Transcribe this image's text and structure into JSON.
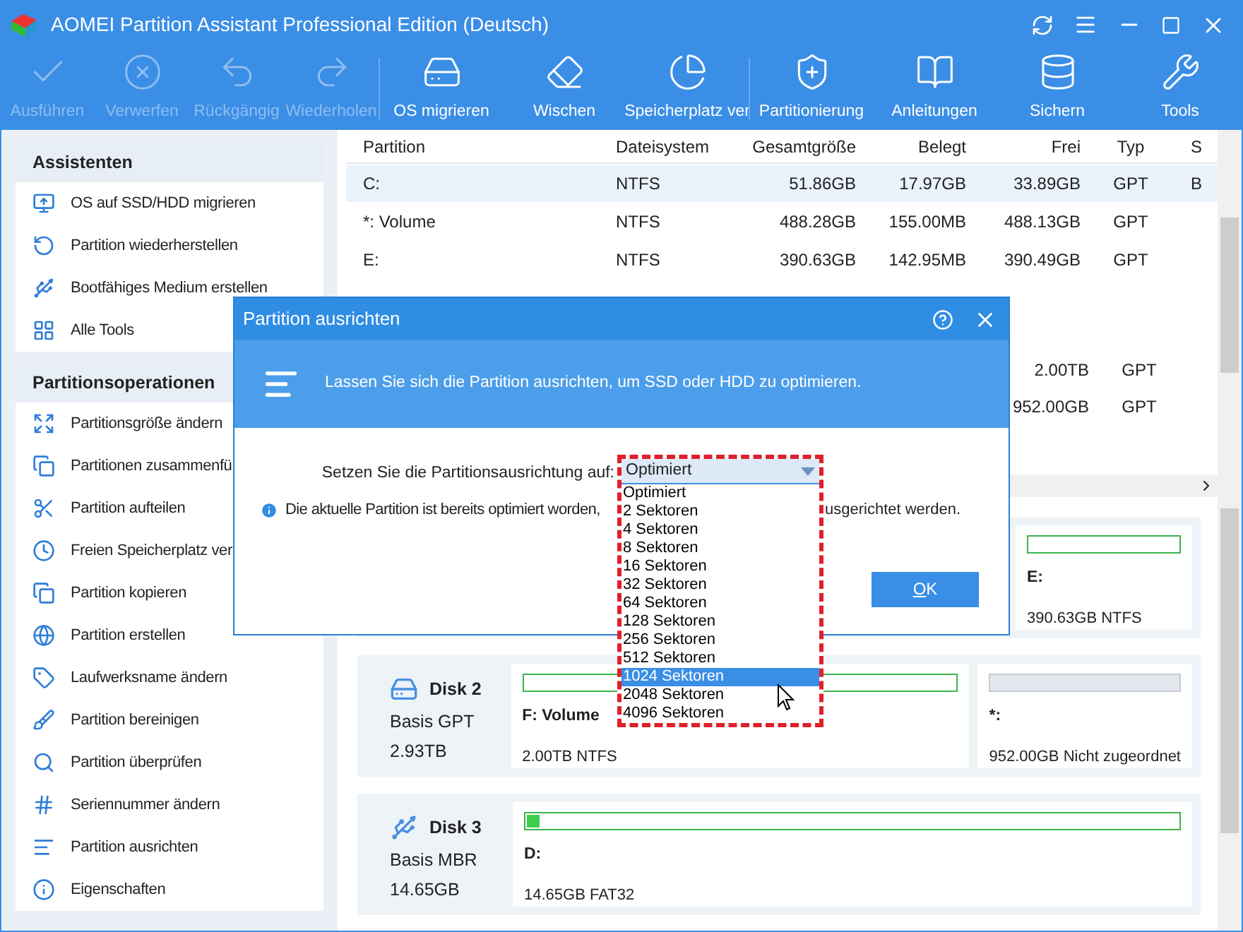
{
  "window": {
    "title": "AOMEI Partition Assistant Professional Edition (Deutsch)"
  },
  "toolbar": [
    {
      "label": "Ausführen",
      "disabled": true
    },
    {
      "label": "Verwerfen",
      "disabled": true
    },
    {
      "label": "Rückgängig",
      "disabled": true
    },
    {
      "label": "Wiederholen",
      "disabled": true
    },
    {
      "label": "OS migrieren",
      "disabled": false
    },
    {
      "label": "Wischen",
      "disabled": false
    },
    {
      "label": "Speicherplatz ver",
      "disabled": false
    },
    {
      "label": "Partitionierung",
      "disabled": false
    },
    {
      "label": "Anleitungen",
      "disabled": false
    },
    {
      "label": "Sichern",
      "disabled": false
    },
    {
      "label": "Tools",
      "disabled": false
    }
  ],
  "sidebar": {
    "sections": [
      {
        "title": "Assistenten",
        "items": [
          "OS auf SSD/HDD migrieren",
          "Partition wiederherstellen",
          "Bootfähiges Medium erstellen",
          "Alle Tools"
        ]
      },
      {
        "title": "Partitionsoperationen",
        "items": [
          "Partitionsgröße ändern",
          "Partitionen zusammenfü",
          "Partition aufteilen",
          "Freien Speicherplatz ver",
          "Partition kopieren",
          "Partition erstellen",
          "Laufwerksname ändern",
          "Partition bereinigen",
          "Partition überprüfen",
          "Seriennummer ändern",
          "Partition ausrichten",
          "Eigenschaften"
        ]
      }
    ]
  },
  "table": {
    "columns": [
      "Partition",
      "Dateisystem",
      "Gesamtgröße",
      "Belegt",
      "Frei",
      "Typ",
      "S"
    ],
    "rows": [
      {
        "partition": "C:",
        "dateisystem": "NTFS",
        "gesamt": "51.86GB",
        "belegt": "17.97GB",
        "frei": "33.89GB",
        "typ": "GPT",
        "column_7": "B",
        "selected": true
      },
      {
        "partition": "*: Volume",
        "dateisystem": "NTFS",
        "gesamt": "488.28GB",
        "belegt": "155.00MB",
        "frei": "488.13GB",
        "typ": "GPT",
        "selected": false
      },
      {
        "partition": "E:",
        "dateisystem": "NTFS",
        "gesamt": "390.63GB",
        "belegt": "142.95MB",
        "frei": "390.49GB",
        "typ": "GPT",
        "selected": false
      }
    ],
    "rows_partly_hidden": [
      {
        "frei": "2.00TB",
        "typ": "GPT"
      },
      {
        "frei": "952.00GB",
        "typ": "GPT"
      }
    ]
  },
  "disks": [
    {
      "partitions": [
        {
          "kind": "hidden"
        },
        {
          "kind": "hidden"
        },
        {
          "kind": "partition",
          "name": "E:",
          "info": "390.63GB NTFS"
        }
      ]
    },
    {
      "name": "Disk 2",
      "kind": "hdd",
      "type": "Basis GPT",
      "size": "2.93TB",
      "partitions": [
        {
          "kind": "partition",
          "name": "F: Volume",
          "info": "2.00TB NTFS"
        },
        {
          "kind": "unallocated",
          "name": "*:",
          "info": "952.00GB Nicht zugeordnet"
        }
      ]
    },
    {
      "name": "Disk 3",
      "kind": "usb",
      "type": "Basis MBR",
      "size": "14.65GB",
      "partitions": [
        {
          "kind": "partition",
          "name": "D:",
          "info": "14.65GB FAT32",
          "level": 0.02
        }
      ]
    }
  ],
  "dialog": {
    "title": "Partition ausrichten",
    "banner": "Lassen Sie sich die Partition ausrichten, um SSD oder HDD zu optimieren.",
    "label": "Setzen Sie die Partitionsausrichtung auf:",
    "select_value": "Optimiert",
    "info_start": "Die aktuelle Partition ist bereits optimiert worden,",
    "info_end": "usgerichtet werden.",
    "ok_button": "OK",
    "options": [
      {
        "label": "Optimiert",
        "selected": false
      },
      {
        "label": "2 Sektoren",
        "selected": false
      },
      {
        "label": "4 Sektoren",
        "selected": false
      },
      {
        "label": "8 Sektoren",
        "selected": false
      },
      {
        "label": "16 Sektoren",
        "selected": false
      },
      {
        "label": "32 Sektoren",
        "selected": false
      },
      {
        "label": "64 Sektoren",
        "selected": false
      },
      {
        "label": "128 Sektoren",
        "selected": false
      },
      {
        "label": "256 Sektoren",
        "selected": false
      },
      {
        "label": "512 Sektoren",
        "selected": false
      },
      {
        "label": "1024 Sektoren",
        "selected": true
      },
      {
        "label": "2048 Sektoren",
        "selected": false
      },
      {
        "label": "4096 Sektoren",
        "selected": false
      }
    ]
  }
}
